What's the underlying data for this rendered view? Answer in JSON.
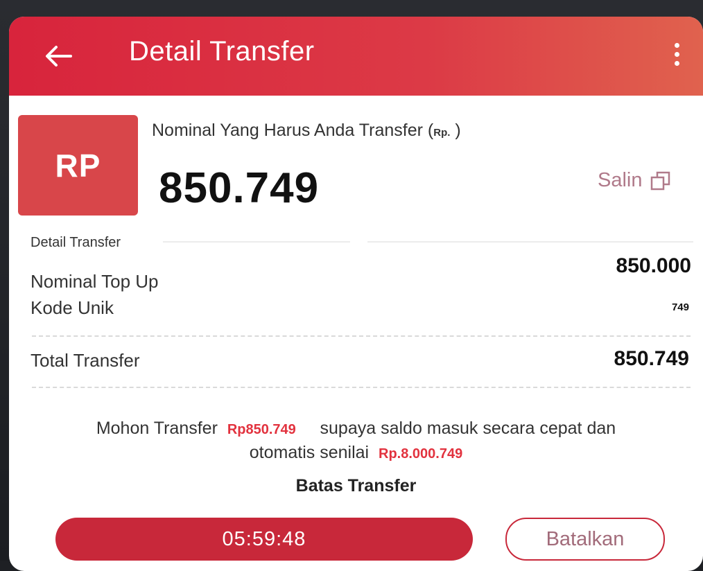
{
  "header": {
    "title": "Detail Transfer",
    "back_icon": "arrow-left-icon",
    "menu_icon": "more-vertical-icon",
    "color": "#d8243c"
  },
  "summary": {
    "badge": "RP",
    "label": "Nominal Yang Harus Anda Transfer (",
    "label_unit": "Rp.",
    "label_close": " )",
    "amount": "850.749",
    "copy_label": "Salin",
    "copy_icon": "copy-icon"
  },
  "details": {
    "section_title": "Detail Transfer",
    "topup_label": "Nominal Top Up",
    "topup_value": "850.000",
    "code_label": "Kode Unik",
    "code_value": "749",
    "total_label": "Total Transfer",
    "total_value": "850.749"
  },
  "note": {
    "part1": "Mohon Transfer",
    "amount": "Rp850.749",
    "part2": "supaya saldo masuk secara cepat dan",
    "part3": "otomatis senilai",
    "amount2": "Rp.8.000.749"
  },
  "deadline": {
    "label": "Batas Transfer",
    "timer": "05:59:48",
    "cancel_label": "Batalkan"
  }
}
